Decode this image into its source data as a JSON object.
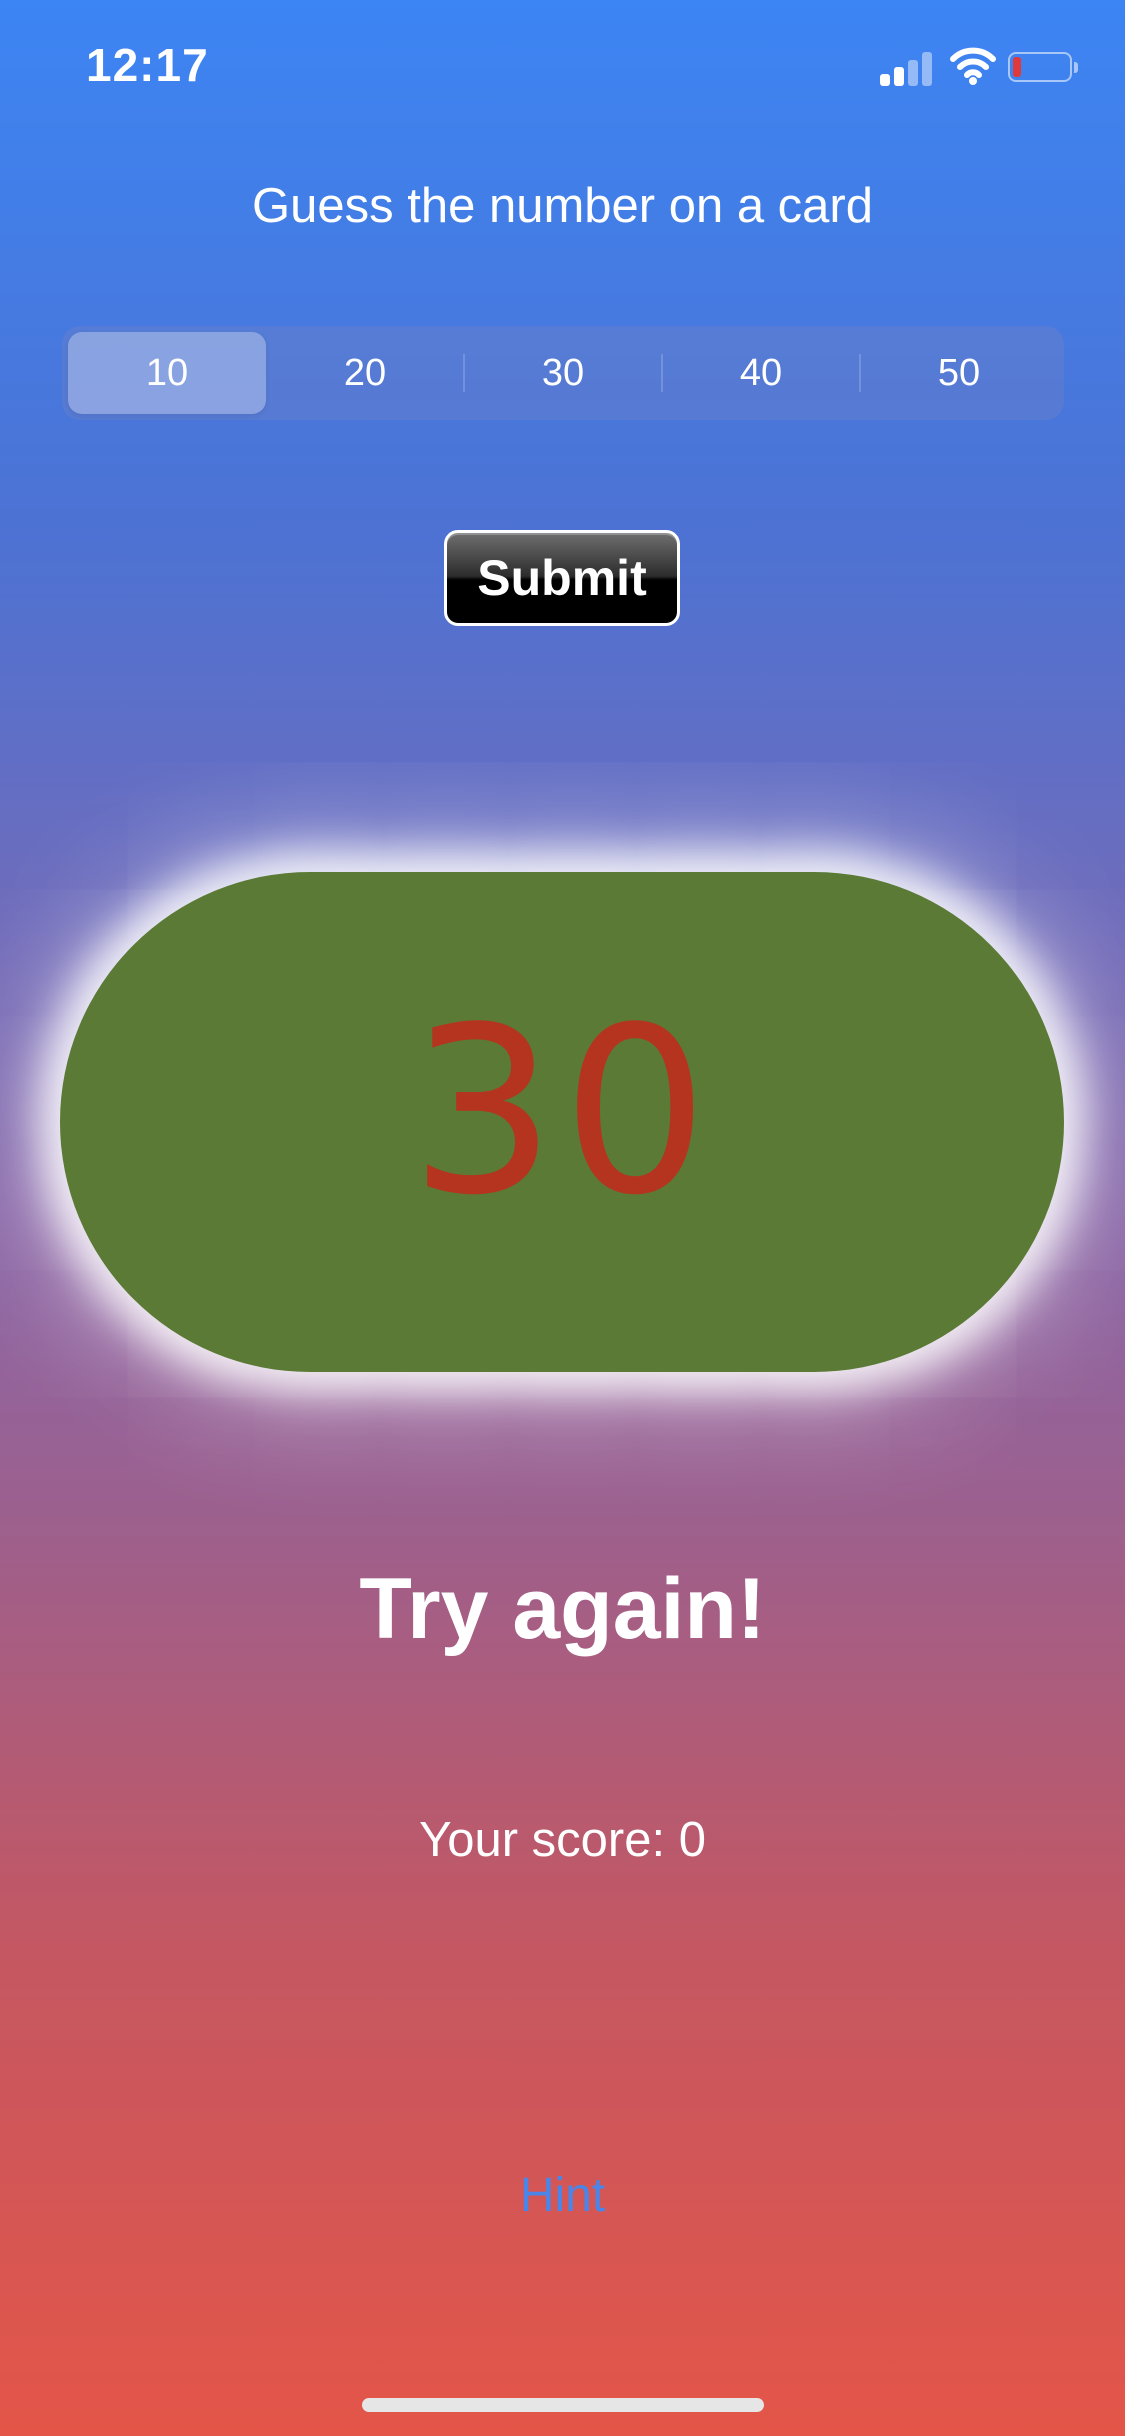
{
  "status_bar": {
    "time": "12:17",
    "battery_level": 0.1,
    "battery_color": "#e0393b"
  },
  "prompt": "Guess the number on a card",
  "segmented_control": {
    "options": [
      "10",
      "20",
      "30",
      "40",
      "50"
    ],
    "selected": "10"
  },
  "submit_label": "Submit",
  "card": {
    "number": "30",
    "background": "#5a7a35",
    "number_color": "#b5341f"
  },
  "result": "Try again!",
  "score_text": "Your score: 0",
  "hint": {
    "label": "Hint",
    "color": "#4a86e8"
  }
}
